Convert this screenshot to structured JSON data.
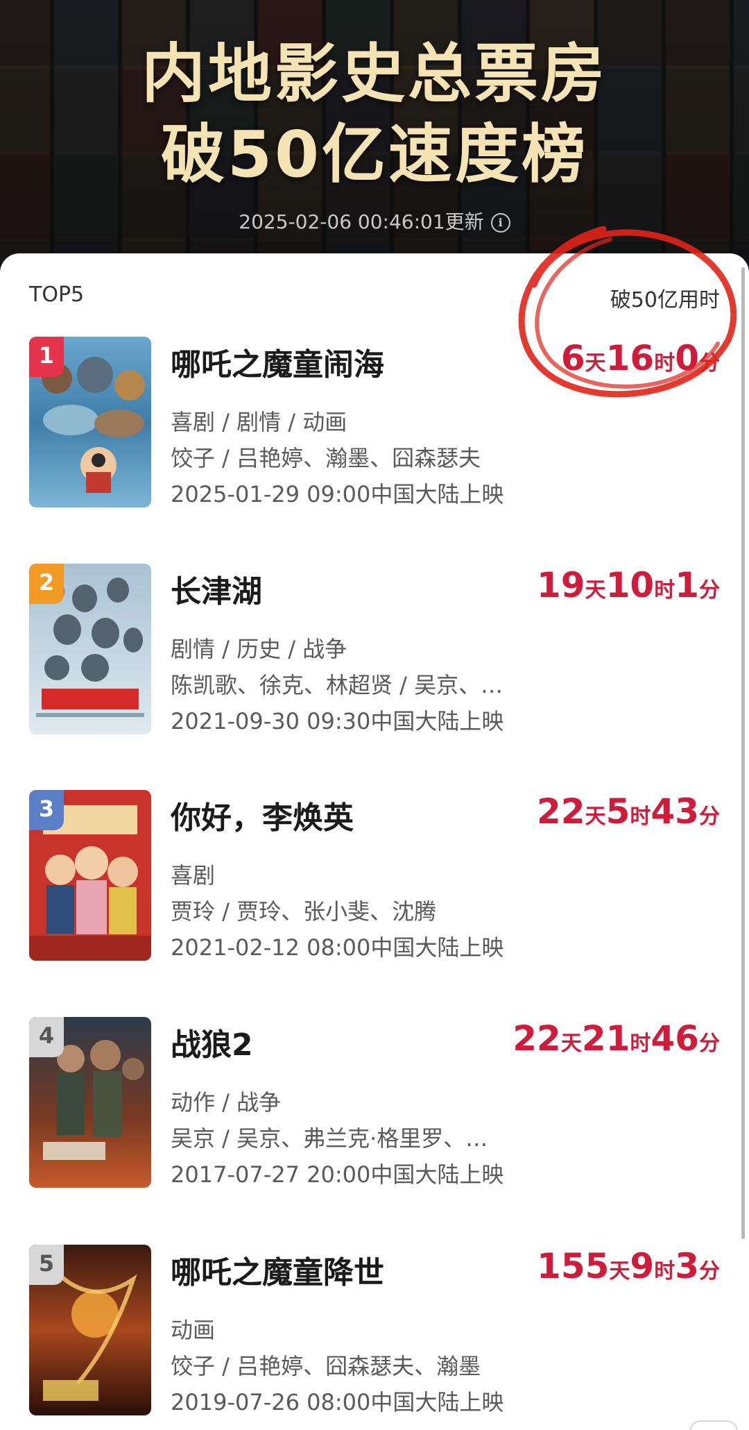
{
  "header": {
    "title_line1": "内地影史总票房",
    "title_line2": "破50亿速度榜",
    "update_time": "2025-02-06 00:46:01更新",
    "info_icon": "info-icon"
  },
  "list": {
    "left_label": "TOP5",
    "right_label": "破50亿用时",
    "items": [
      {
        "rank": "1",
        "badge_color": "#e5334b",
        "title": "哪吒之魔童闹海",
        "time": [
          {
            "n": "6",
            "u": "天"
          },
          {
            "n": "16",
            "u": "时"
          },
          {
            "n": "0",
            "u": "分"
          }
        ],
        "genre": "喜剧 / 剧情 / 动画",
        "crew": "饺子 / 吕艳婷、瀚墨、囧森瑟夫",
        "release": "2025-01-29 09:00中国大陆上映"
      },
      {
        "rank": "2",
        "badge_color": "#f19a25",
        "title": "长津湖",
        "time": [
          {
            "n": "19",
            "u": "天"
          },
          {
            "n": "10",
            "u": "时"
          },
          {
            "n": "1",
            "u": "分"
          }
        ],
        "genre": "剧情 / 历史 / 战争",
        "crew": "陈凯歌、徐克、林超贤 / 吴京、…",
        "release": "2021-09-30 09:30中国大陆上映"
      },
      {
        "rank": "3",
        "badge_color": "#5b7fc6",
        "title": "你好，李焕英",
        "time": [
          {
            "n": "22",
            "u": "天"
          },
          {
            "n": "5",
            "u": "时"
          },
          {
            "n": "43",
            "u": "分"
          }
        ],
        "genre": "喜剧",
        "crew": "贾玲 / 贾玲、张小斐、沈腾",
        "release": "2021-02-12 08:00中国大陆上映"
      },
      {
        "rank": "4",
        "badge_color": "#d7d7d7",
        "title": "战狼2",
        "time": [
          {
            "n": "22",
            "u": "天"
          },
          {
            "n": "21",
            "u": "时"
          },
          {
            "n": "46",
            "u": "分"
          }
        ],
        "genre": "动作 / 战争",
        "crew": "吴京 / 吴京、弗兰克·格里罗、…",
        "release": "2017-07-27 20:00中国大陆上映"
      },
      {
        "rank": "5",
        "badge_color": "#d7d7d7",
        "title": "哪吒之魔童降世",
        "time": [
          {
            "n": "155",
            "u": "天"
          },
          {
            "n": "9",
            "u": "时"
          },
          {
            "n": "3",
            "u": "分"
          }
        ],
        "genre": "动画",
        "crew": "饺子 / 吕艳婷、囧森瑟夫、瀚墨",
        "release": "2019-07-26 08:00中国大陆上映"
      }
    ]
  },
  "colors": {
    "accent_red": "#d01c3a",
    "title_gold": "#f6e3b4"
  }
}
